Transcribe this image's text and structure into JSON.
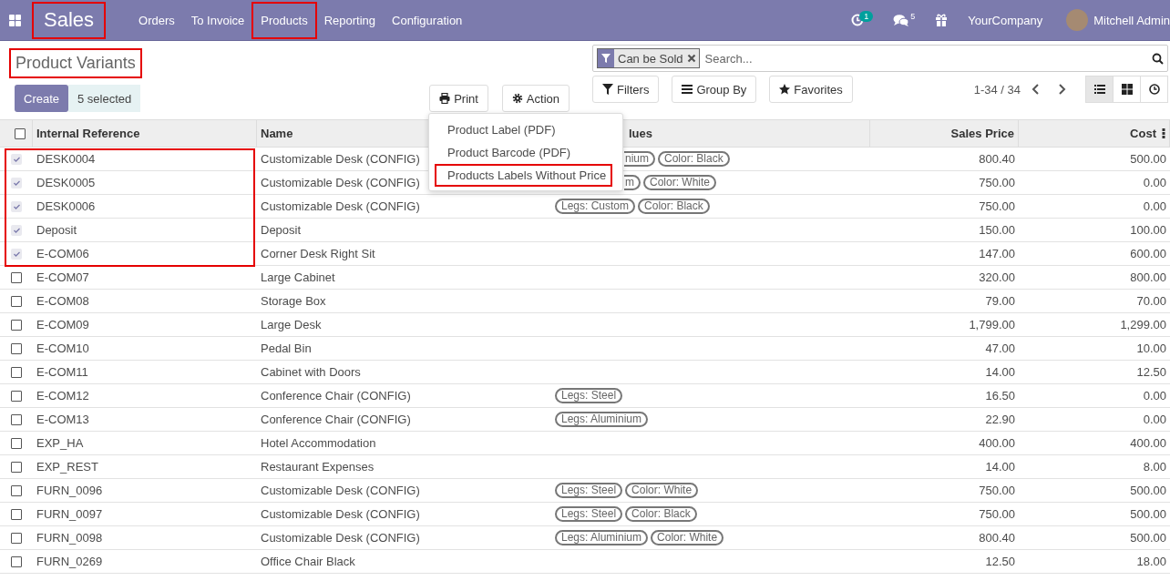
{
  "navbar": {
    "app": {
      "label": "Sales",
      "highlight": true
    },
    "menus": [
      {
        "label": "Orders",
        "highlight": false
      },
      {
        "label": "To Invoice",
        "highlight": false
      },
      {
        "label": "Products",
        "highlight": true
      },
      {
        "label": "Reporting",
        "highlight": false
      },
      {
        "label": "Configuration",
        "highlight": false
      }
    ],
    "activity_count": "1",
    "messages_count": "5",
    "company": "YourCompany",
    "user": "Mitchell Admin"
  },
  "control_panel": {
    "title": {
      "label": "Product Variants",
      "highlight": true
    },
    "create": "Create",
    "selection": "5 selected",
    "print": "Print",
    "action": "Action",
    "print_menu": [
      {
        "label": "Product Label (PDF)",
        "highlight": false
      },
      {
        "label": "Product Barcode (PDF)",
        "highlight": false
      },
      {
        "label": "Products Labels Without Price",
        "highlight": true
      }
    ],
    "search": {
      "facet": "Can be Sold",
      "placeholder": "Search..."
    },
    "filters": "Filters",
    "group_by": "Group By",
    "favorites": "Favorites",
    "pager": "1-34 / 34",
    "views": [
      {
        "kind": "list",
        "selected": true
      },
      {
        "kind": "kanban",
        "selected": false
      },
      {
        "kind": "activity",
        "selected": false
      }
    ]
  },
  "table": {
    "highlight_selected": true,
    "all_selected": false,
    "columns": [
      "Internal Reference",
      "Name",
      "lues",
      "Sales Price",
      "Cost"
    ],
    "rows": [
      {
        "selected": true,
        "reference": "DESK0004",
        "name": "Customizable Desk (CONFIG)",
        "values": [
          {
            "label": "nium",
            "cut": true
          },
          {
            "label": "Color: Black",
            "cut": false
          }
        ],
        "price": "800.40",
        "cost": "500.00"
      },
      {
        "selected": true,
        "reference": "DESK0005",
        "name": "Customizable Desk (CONFIG)",
        "values": [
          {
            "label": "m",
            "cut": true
          },
          {
            "label": "Color: White",
            "cut": false
          }
        ],
        "price": "750.00",
        "cost": "0.00"
      },
      {
        "selected": true,
        "reference": "DESK0006",
        "name": "Customizable Desk (CONFIG)",
        "values": [
          {
            "label": "Legs: Custom",
            "cut": false
          },
          {
            "label": "Color: Black",
            "cut": false
          }
        ],
        "price": "750.00",
        "cost": "0.00"
      },
      {
        "selected": true,
        "reference": "Deposit",
        "name": "Deposit",
        "values": [],
        "price": "150.00",
        "cost": "100.00"
      },
      {
        "selected": true,
        "reference": "E-COM06",
        "name": "Corner Desk Right Sit",
        "values": [],
        "price": "147.00",
        "cost": "600.00"
      },
      {
        "selected": false,
        "reference": "E-COM07",
        "name": "Large Cabinet",
        "values": [],
        "price": "320.00",
        "cost": "800.00"
      },
      {
        "selected": false,
        "reference": "E-COM08",
        "name": "Storage Box",
        "values": [],
        "price": "79.00",
        "cost": "70.00"
      },
      {
        "selected": false,
        "reference": "E-COM09",
        "name": "Large Desk",
        "values": [],
        "price": "1,799.00",
        "cost": "1,299.00"
      },
      {
        "selected": false,
        "reference": "E-COM10",
        "name": "Pedal Bin",
        "values": [],
        "price": "47.00",
        "cost": "10.00"
      },
      {
        "selected": false,
        "reference": "E-COM11",
        "name": "Cabinet with Doors",
        "values": [],
        "price": "14.00",
        "cost": "12.50"
      },
      {
        "selected": false,
        "reference": "E-COM12",
        "name": "Conference Chair (CONFIG)",
        "values": [
          {
            "label": "Legs: Steel",
            "cut": false
          }
        ],
        "price": "16.50",
        "cost": "0.00"
      },
      {
        "selected": false,
        "reference": "E-COM13",
        "name": "Conference Chair (CONFIG)",
        "values": [
          {
            "label": "Legs: Aluminium",
            "cut": false
          }
        ],
        "price": "22.90",
        "cost": "0.00"
      },
      {
        "selected": false,
        "reference": "EXP_HA",
        "name": "Hotel Accommodation",
        "values": [],
        "price": "400.00",
        "cost": "400.00"
      },
      {
        "selected": false,
        "reference": "EXP_REST",
        "name": "Restaurant Expenses",
        "values": [],
        "price": "14.00",
        "cost": "8.00"
      },
      {
        "selected": false,
        "reference": "FURN_0096",
        "name": "Customizable Desk (CONFIG)",
        "values": [
          {
            "label": "Legs: Steel",
            "cut": false
          },
          {
            "label": "Color: White",
            "cut": false
          }
        ],
        "price": "750.00",
        "cost": "500.00"
      },
      {
        "selected": false,
        "reference": "FURN_0097",
        "name": "Customizable Desk (CONFIG)",
        "values": [
          {
            "label": "Legs: Steel",
            "cut": false
          },
          {
            "label": "Color: Black",
            "cut": false
          }
        ],
        "price": "750.00",
        "cost": "500.00"
      },
      {
        "selected": false,
        "reference": "FURN_0098",
        "name": "Customizable Desk (CONFIG)",
        "values": [
          {
            "label": "Legs: Aluminium",
            "cut": false
          },
          {
            "label": "Color: White",
            "cut": false
          }
        ],
        "price": "800.40",
        "cost": "500.00"
      },
      {
        "selected": false,
        "reference": "FURN_0269",
        "name": "Office Chair Black",
        "values": [],
        "price": "12.50",
        "cost": "18.00"
      }
    ]
  }
}
